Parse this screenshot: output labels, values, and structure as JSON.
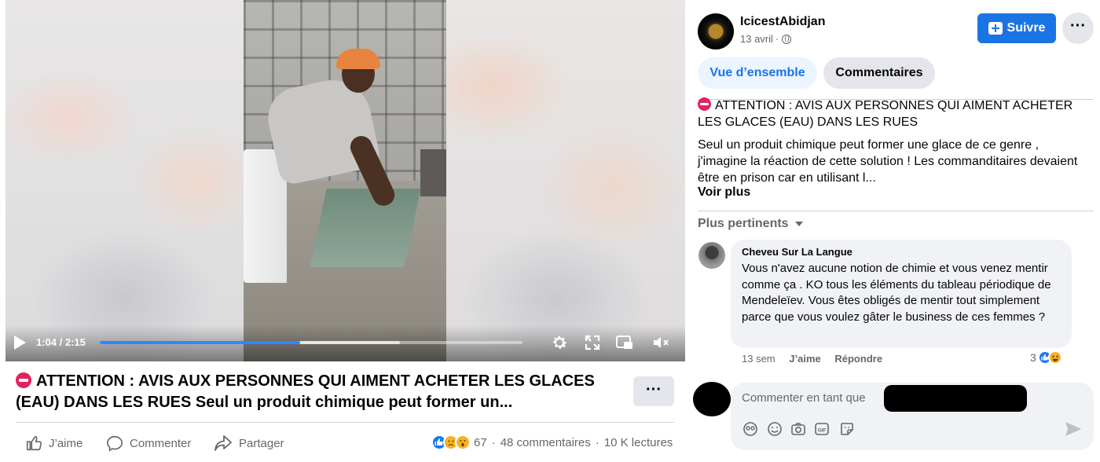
{
  "video": {
    "current_time": "1:04",
    "duration": "2:15",
    "progress_fraction": 0.474,
    "buffer_fraction": 0.71,
    "icons": [
      "play-icon",
      "settings-icon",
      "fullscreen-icon",
      "pip-icon",
      "mute-icon"
    ]
  },
  "post": {
    "title": "ATTENTION : AVIS AUX PERSONNES QUI AIMENT ACHETER LES GLACES (EAU) DANS LES RUES Seul un produit chimique peut former un...",
    "heading": "ATTENTION : AVIS AUX PERSONNES QUI AIMENT ACHETER LES GLACES (EAU) DANS LES RUES",
    "body": "Seul un produit chimique peut former une glace de ce genre , j'imagine la réaction de cette solution ! Les commanditaires devaient être en prison car en utilisant l...",
    "see_more": "Voir plus",
    "more_label": "···"
  },
  "actions": {
    "like": "J’aime",
    "comment": "Commenter",
    "share": "Partager"
  },
  "stats": {
    "reaction_count": "67",
    "comments": "48 commentaires",
    "separator": "·",
    "views": "10 K lectures"
  },
  "page": {
    "name": "IcicestAbidjan",
    "date": "13 avril",
    "follow_label": "Suivre",
    "more_label": "···"
  },
  "tabs": {
    "overview": "Vue d’ensemble",
    "comments": "Commentaires"
  },
  "comments_section": {
    "sort_label": "Plus pertinents",
    "items": [
      {
        "author": "Cheveu Sur La Langue",
        "text": "Vous n'avez aucune notion de chimie et vous venez mentir comme ça . KO tous les éléments du tableau périodique de Mendeleïev. Vous êtes obligés de mentir tout simplement parce que vous voulez gâter le business de ces femmes ?",
        "time": "13 sem",
        "like_label": "J’aime",
        "reply_label": "Répondre",
        "reaction_count": "3"
      }
    ]
  },
  "composer": {
    "placeholder": "Commenter en tant que"
  },
  "colors": {
    "brand_blue": "#1b74e4",
    "progress_blue": "#2d88ff",
    "stop_red": "#e0245e"
  }
}
